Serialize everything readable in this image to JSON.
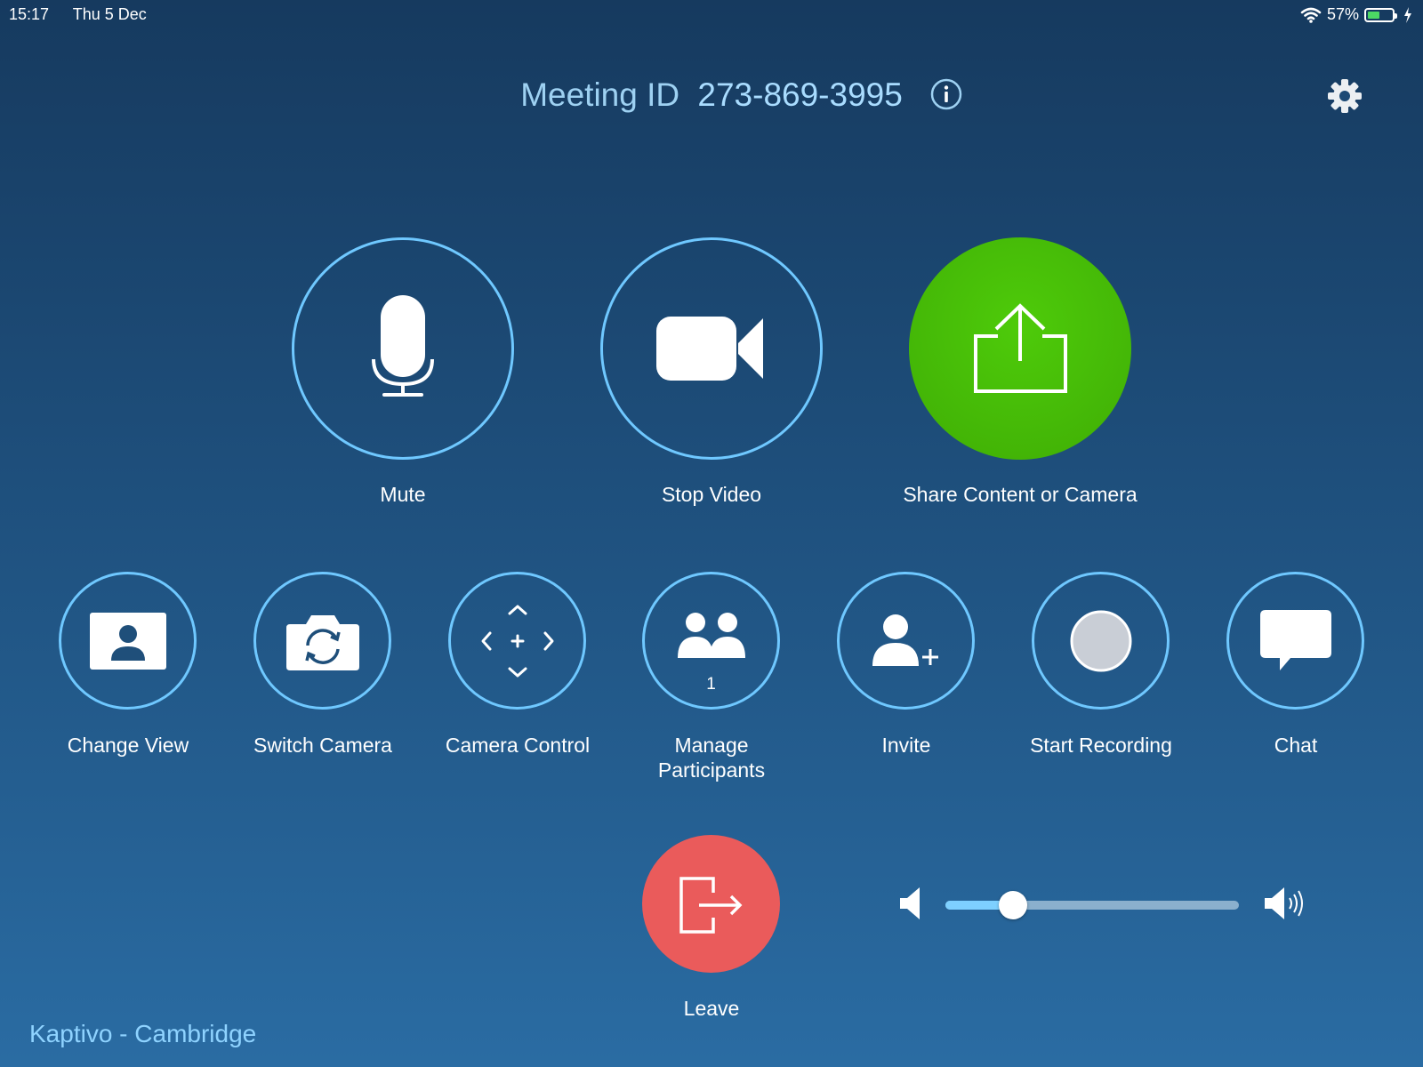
{
  "status_bar": {
    "time": "15:17",
    "date": "Thu 5 Dec",
    "battery_percent_text": "57%",
    "battery_level": 0.57,
    "icons": [
      "wifi-icon",
      "battery-icon",
      "charging-bolt-icon"
    ]
  },
  "header": {
    "meeting_label": "Meeting ID",
    "meeting_id": "273-869-3995",
    "icons": [
      "info-icon",
      "gear-icon"
    ]
  },
  "primary_actions": [
    {
      "label": "Mute",
      "icon": "microphone-icon"
    },
    {
      "label": "Stop Video",
      "icon": "video-camera-icon"
    },
    {
      "label": "Share Content or Camera",
      "icon": "share-upload-icon"
    }
  ],
  "secondary_actions": [
    {
      "label": "Change View",
      "icon": "change-view-icon"
    },
    {
      "label": "Switch Camera",
      "icon": "switch-camera-icon"
    },
    {
      "label": "Camera Control",
      "icon": "camera-control-icon"
    },
    {
      "label": "Manage Participants",
      "icon": "participants-icon",
      "count": "1"
    },
    {
      "label": "Invite",
      "icon": "invite-person-icon"
    },
    {
      "label": "Start Recording",
      "icon": "record-icon"
    },
    {
      "label": "Chat",
      "icon": "chat-bubble-icon"
    }
  ],
  "leave": {
    "label": "Leave",
    "icon": "leave-exit-icon"
  },
  "volume": {
    "level": 0.23,
    "icons": [
      "volume-low-icon",
      "volume-high-icon"
    ]
  },
  "room_name": "Kaptivo - Cambridge",
  "colors": {
    "accent_outline": "#6fc8ff",
    "share_green": "#43b806",
    "leave_red": "#ea5b5b",
    "room_name": "#8fd3ff",
    "battery_fill": "#4cd964"
  }
}
